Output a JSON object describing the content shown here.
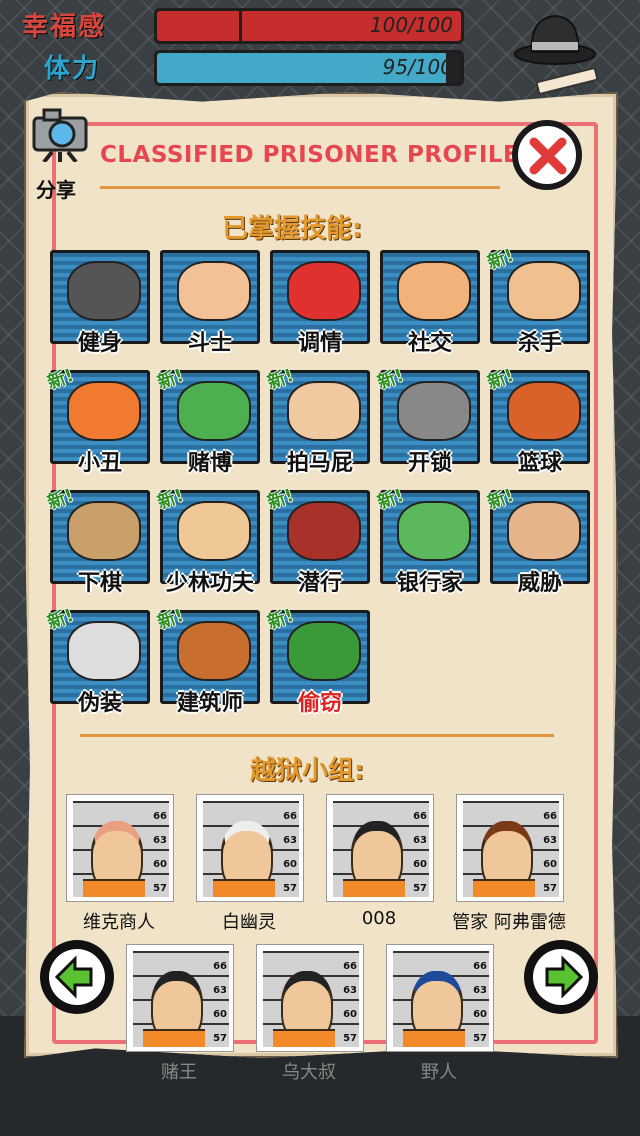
{
  "stats": [
    {
      "label": "幸福感",
      "value": "100/100",
      "fill": 1.0,
      "color": "#c62d2d",
      "labelColor": "#d24a3a"
    },
    {
      "label": "体力",
      "value": "95/100",
      "fill": 0.95,
      "color": "#3fa6c6",
      "labelColor": "#27a0c9"
    }
  ],
  "profile": {
    "title": "CLASSIFIED PRISONER PROFILE",
    "share_label": "分享",
    "skills_heading": "已掌握技能:",
    "team_heading": "越狱小组:"
  },
  "skills": [
    {
      "label": "健身",
      "new": false,
      "icon": "dumbbell-icon",
      "labelColor": "#111"
    },
    {
      "label": "斗士",
      "new": false,
      "icon": "fist-icon",
      "labelColor": "#111"
    },
    {
      "label": "调情",
      "new": false,
      "icon": "love-heart-icon",
      "labelColor": "#111"
    },
    {
      "label": "社交",
      "new": false,
      "icon": "handshake-icon",
      "labelColor": "#111"
    },
    {
      "label": "杀手",
      "new": true,
      "icon": "knife-hand-icon",
      "labelColor": "#111"
    },
    {
      "label": "小丑",
      "new": true,
      "icon": "clown-icon",
      "labelColor": "#111"
    },
    {
      "label": "赌博",
      "new": true,
      "icon": "cards-money-icon",
      "labelColor": "#111"
    },
    {
      "label": "拍马屁",
      "new": true,
      "icon": "butt-icon",
      "labelColor": "#111"
    },
    {
      "label": "开锁",
      "new": true,
      "icon": "lockpick-icon",
      "labelColor": "#111"
    },
    {
      "label": "篮球",
      "new": true,
      "icon": "basketball-icon",
      "labelColor": "#111"
    },
    {
      "label": "下棋",
      "new": true,
      "icon": "chessboard-icon",
      "labelColor": "#111"
    },
    {
      "label": "少林功夫",
      "new": true,
      "icon": "kungfu-icon",
      "labelColor": "#111"
    },
    {
      "label": "潜行",
      "new": true,
      "icon": "ninja-icon",
      "labelColor": "#111"
    },
    {
      "label": "银行家",
      "new": true,
      "icon": "banker-icon",
      "labelColor": "#111"
    },
    {
      "label": "威胁",
      "new": true,
      "icon": "angry-face-icon",
      "labelColor": "#111"
    },
    {
      "label": "伪装",
      "new": true,
      "icon": "disguise-icon",
      "labelColor": "#111"
    },
    {
      "label": "建筑师",
      "new": true,
      "icon": "house-pencil-icon",
      "labelColor": "#111"
    },
    {
      "label": "偷窃",
      "new": true,
      "icon": "dollar-hand-icon",
      "labelColor": "#e02020"
    }
  ],
  "new_badge": "新!",
  "team": [
    {
      "name": "维克商人"
    },
    {
      "name": "白幽灵"
    },
    {
      "name": "008"
    },
    {
      "name": "管家 阿弗雷德"
    },
    {
      "name": "赌王"
    },
    {
      "name": "乌大叔"
    },
    {
      "name": "野人"
    }
  ],
  "mugshot_numbers": [
    "66",
    "63",
    "60",
    "57"
  ],
  "colors": {
    "accent": "#e6464f",
    "orange": "#e4992d",
    "new_green": "#2e8f1e"
  }
}
